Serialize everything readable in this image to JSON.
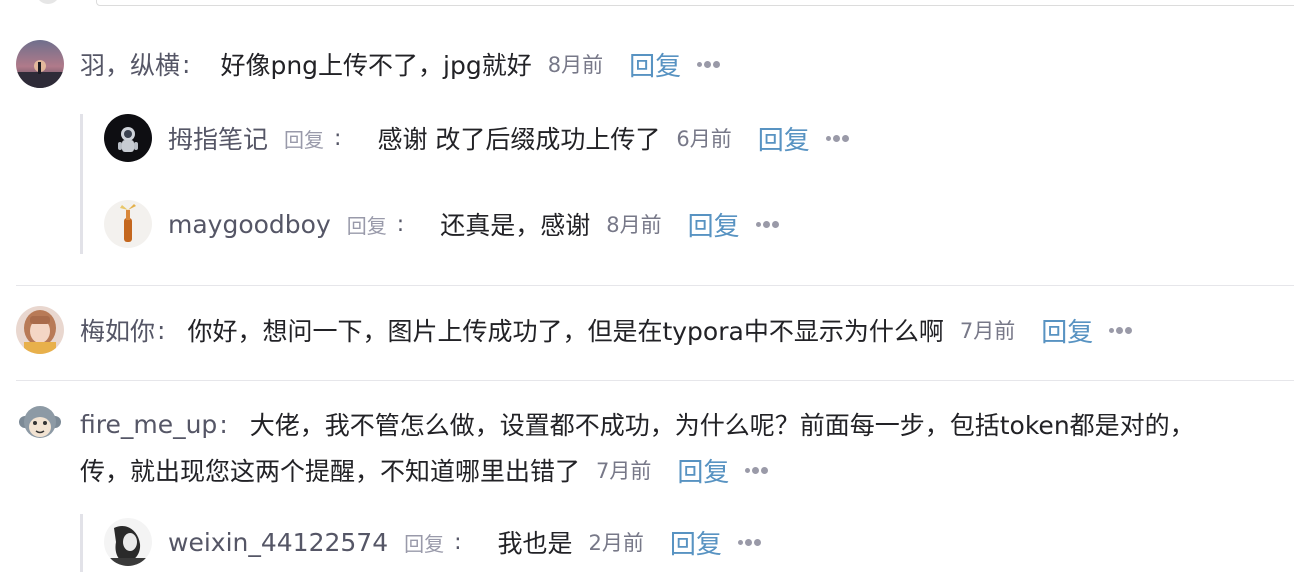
{
  "colors": {
    "link": "#5893c2",
    "name": "#555666",
    "time": "#777888",
    "text": "#222226",
    "divider": "#e6e6ea"
  },
  "comments": [
    {
      "avatar_icon": "avatar-sunset-icon",
      "name": "羽，纵横",
      "colon": ":",
      "content": "好像png上传不了，jpg就好",
      "time": "8月前",
      "reply_label": "回复",
      "replies": [
        {
          "avatar_icon": "avatar-astronaut-icon",
          "name": "拇指笔记",
          "reply_tag": "回复",
          "colon": ":",
          "content": "感谢 改了后缀成功上传了",
          "time": "6月前",
          "reply_label": "回复"
        },
        {
          "avatar_icon": "avatar-bottle-icon",
          "name": "maygoodboy",
          "reply_tag": "回复",
          "colon": ":",
          "content": "还真是，感谢",
          "time": "8月前",
          "reply_label": "回复"
        }
      ]
    },
    {
      "avatar_icon": "avatar-girl-icon",
      "name": "梅如你",
      "colon": ":",
      "content": "你好，想问一下，图片上传成功了，但是在typora中不显示为什么啊",
      "time": "7月前",
      "reply_label": "回复"
    },
    {
      "avatar_icon": "avatar-monkey-icon",
      "name": "fire_me_up",
      "colon": ":",
      "content": "大佬，我不管怎么做，设置都不成功，为什么呢？前面每一步，包括token都是对的，",
      "content_line2": "传，就出现您这两个提醒，不知道哪里出错了",
      "time": "7月前",
      "reply_label": "回复",
      "replies": [
        {
          "avatar_icon": "avatar-sketch-icon",
          "name": "weixin_44122574",
          "reply_tag": "回复",
          "colon": ":",
          "content": "我也是",
          "time": "2月前",
          "reply_label": "回复"
        }
      ]
    }
  ]
}
